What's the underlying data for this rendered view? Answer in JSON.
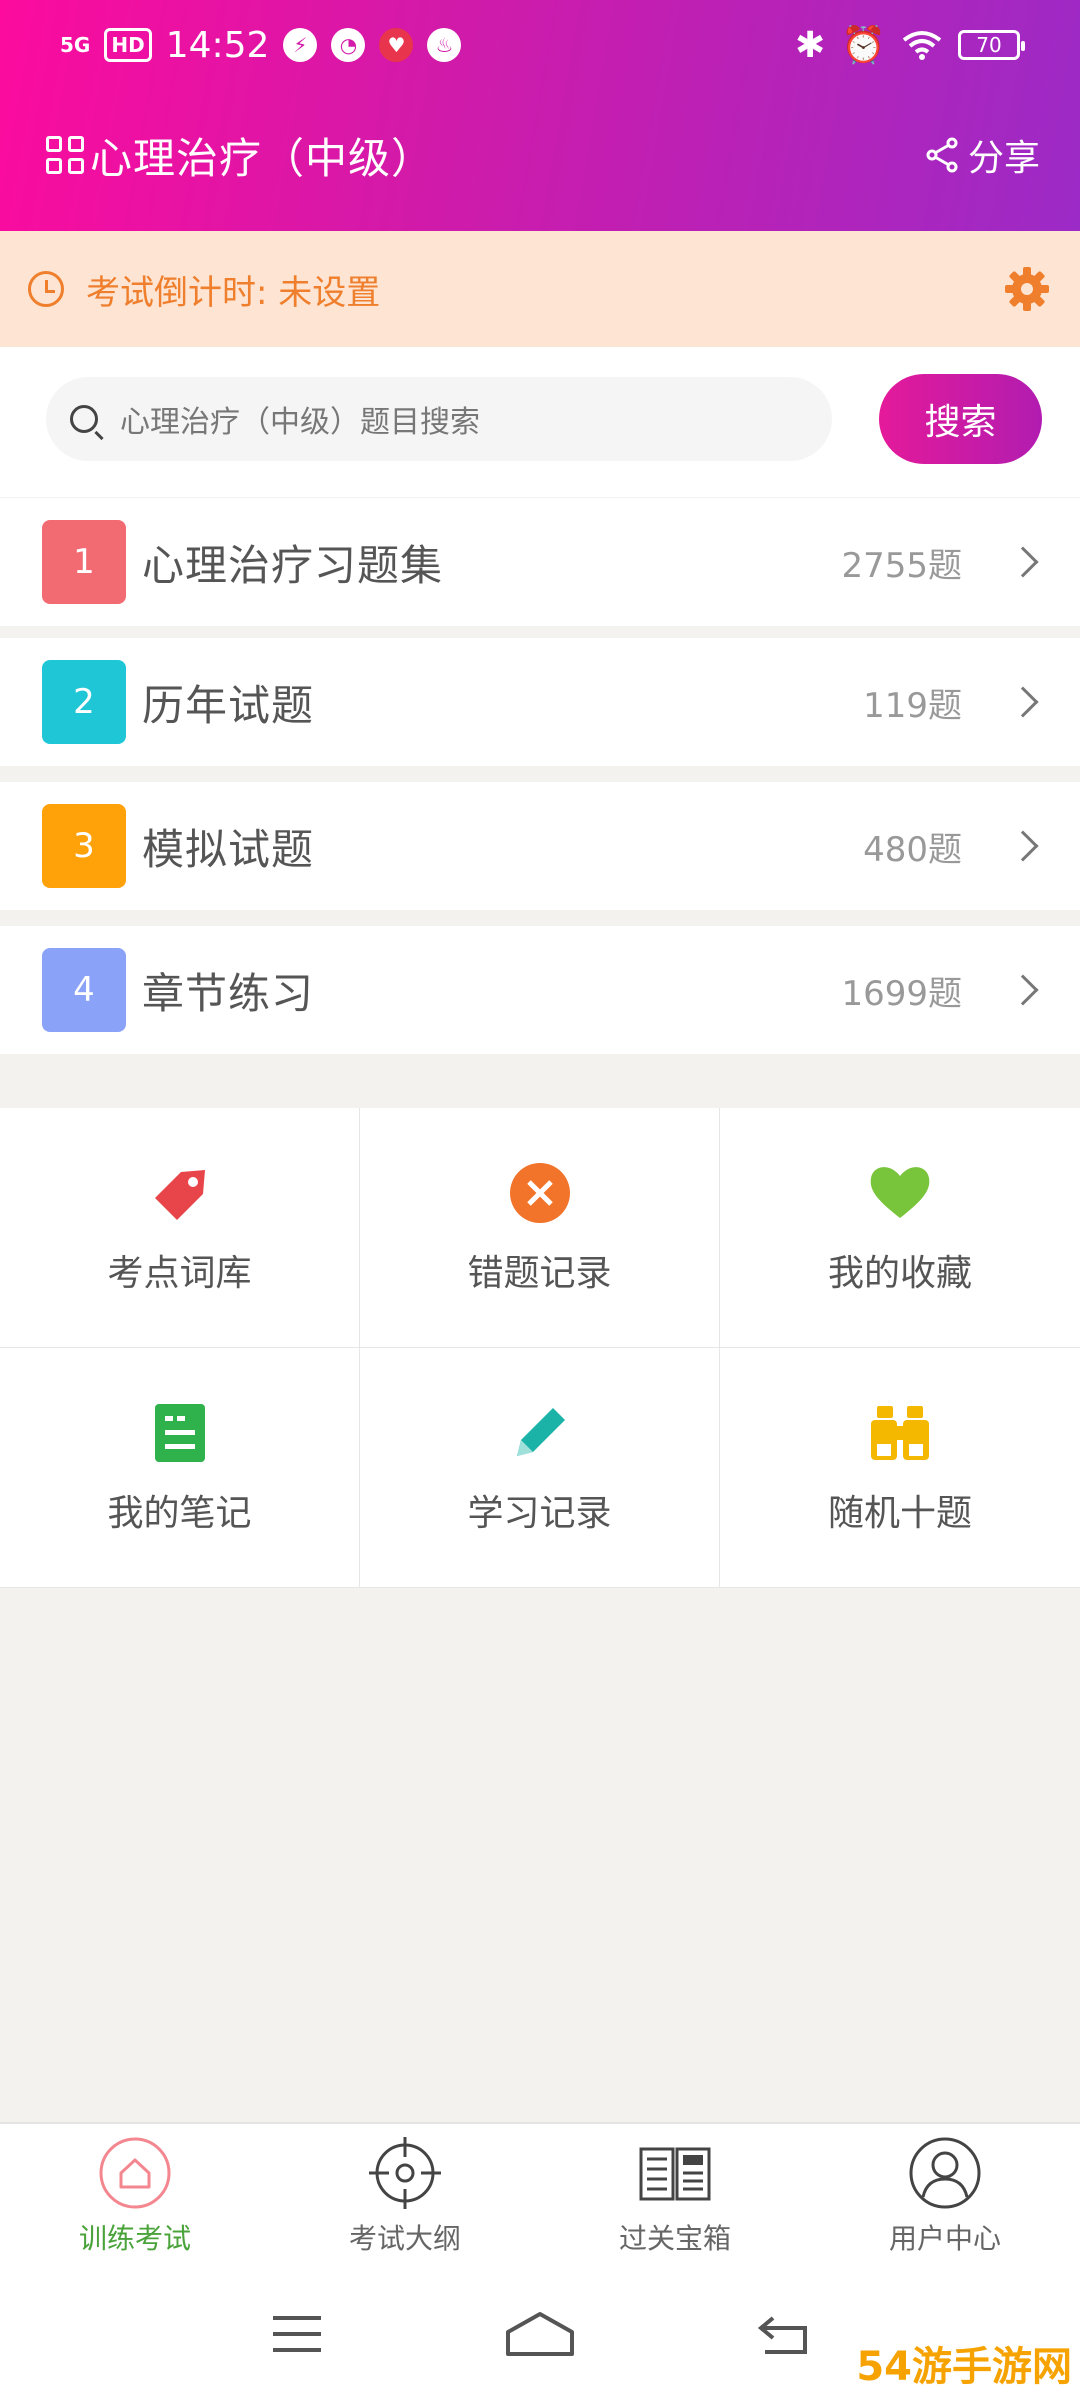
{
  "status_bar": {
    "network": "5G",
    "hd": "HD",
    "time": "14:52",
    "battery": "70"
  },
  "header": {
    "title": "心理治疗（中级）",
    "share_label": "分享"
  },
  "countdown": {
    "text": "考试倒计时: 未设置"
  },
  "search": {
    "placeholder": "心理治疗（中级）题目搜索",
    "button_label": "搜索"
  },
  "question_banks": [
    {
      "num": "1",
      "label": "心理治疗习题集",
      "count": "2755题",
      "color": "#f26b73"
    },
    {
      "num": "2",
      "label": "历年试题",
      "count": "119题",
      "color": "#1fc7d6"
    },
    {
      "num": "3",
      "label": "模拟试题",
      "count": "480题",
      "color": "#ffa20a"
    },
    {
      "num": "4",
      "label": "章节练习",
      "count": "1699题",
      "color": "#8aa2f7"
    }
  ],
  "tools": [
    {
      "label": "考点词库",
      "icon": "tag-icon"
    },
    {
      "label": "错题记录",
      "icon": "wrong-icon"
    },
    {
      "label": "我的收藏",
      "icon": "heart-icon"
    },
    {
      "label": "我的笔记",
      "icon": "note-icon"
    },
    {
      "label": "学习记录",
      "icon": "pencil-icon"
    },
    {
      "label": "随机十题",
      "icon": "binoculars-icon"
    }
  ],
  "tabs": [
    {
      "label": "训练考试",
      "icon": "home-icon",
      "active": true
    },
    {
      "label": "考试大纲",
      "icon": "target-icon",
      "active": false
    },
    {
      "label": "过关宝箱",
      "icon": "news-icon",
      "active": false
    },
    {
      "label": "用户中心",
      "icon": "user-icon",
      "active": false
    }
  ],
  "watermark": "54游手游网"
}
